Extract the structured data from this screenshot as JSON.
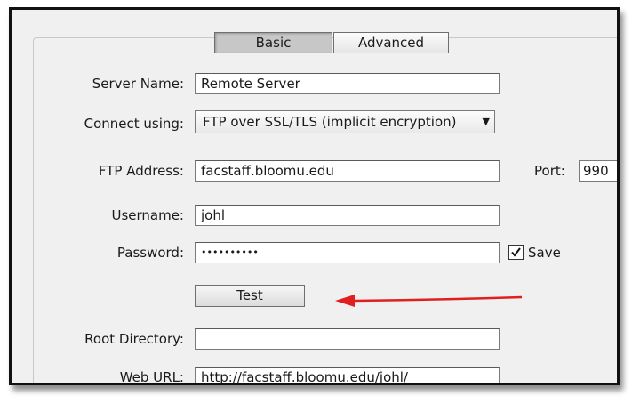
{
  "tabs": {
    "basic": "Basic",
    "advanced": "Advanced"
  },
  "form": {
    "server_name": {
      "label": "Server Name:",
      "value": "Remote Server"
    },
    "connect_using": {
      "label": "Connect using:",
      "value": "FTP over SSL/TLS (implicit encryption)"
    },
    "ftp_address": {
      "label": "FTP Address:",
      "value": "facstaff.bloomu.edu"
    },
    "port": {
      "label": "Port:",
      "value": "990"
    },
    "username": {
      "label": "Username:",
      "value": "johl"
    },
    "password": {
      "label": "Password:",
      "value": "••••••••••"
    },
    "save": {
      "label": "Save",
      "checked": true
    },
    "test_button": "Test",
    "root_directory": {
      "label": "Root Directory:",
      "value": ""
    },
    "web_url": {
      "label": "Web URL:",
      "value": "http://facstaff.bloomu.edu/johl/"
    }
  },
  "annotation": {
    "arrow_color": "#e02020"
  },
  "icons": {
    "dropdown": "triangle-down-icon",
    "checkbox": "checkmark-icon"
  }
}
